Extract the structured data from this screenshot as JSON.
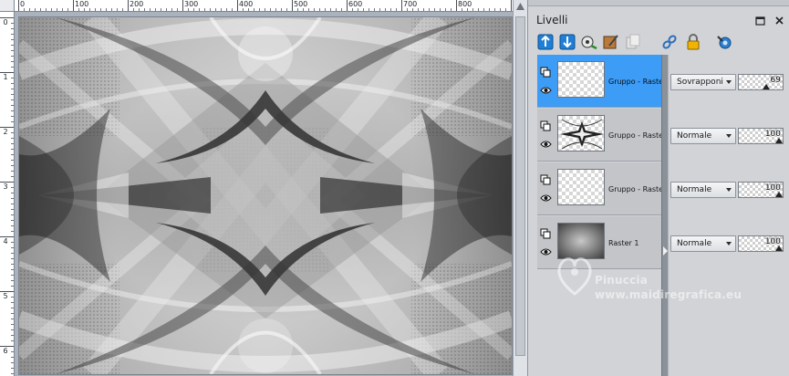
{
  "ruler": {
    "h_labels": [
      "0",
      "100",
      "200",
      "300",
      "400",
      "500",
      "600",
      "700",
      "800"
    ],
    "v_labels": [
      "0",
      "1",
      "2",
      "3",
      "4",
      "5",
      "6"
    ]
  },
  "palette": {
    "title": "Livelli",
    "header_icons": [
      "maximize-icon",
      "close-icon"
    ],
    "toolbar_icons": [
      "new-raster-layer-icon",
      "new-vector-layer-icon",
      "new-adjustment-layer-icon",
      "new-mask-layer-icon",
      "duplicate-layer-icon",
      "link-layers-icon",
      "lock-icon",
      "layer-properties-icon"
    ]
  },
  "layers": [
    {
      "name": "Gruppo - Raste",
      "blend_mode": "Sovrapponi",
      "opacity": "69",
      "opacity_fraction": 0.69,
      "selected": true,
      "thumb": "empty"
    },
    {
      "name": "Gruppo - Raste",
      "blend_mode": "Normale",
      "opacity": "100",
      "opacity_fraction": 1.0,
      "selected": false,
      "thumb": "pattern"
    },
    {
      "name": "Gruppo - Raste",
      "blend_mode": "Normale",
      "opacity": "100",
      "opacity_fraction": 1.0,
      "selected": false,
      "thumb": "empty"
    },
    {
      "name": "Raster 1",
      "blend_mode": "Normale",
      "opacity": "100",
      "opacity_fraction": 1.0,
      "selected": false,
      "thumb": "gradient"
    }
  ],
  "watermark": {
    "line1": "Pinuccia",
    "line2": "www.maidiregrafica.eu"
  }
}
